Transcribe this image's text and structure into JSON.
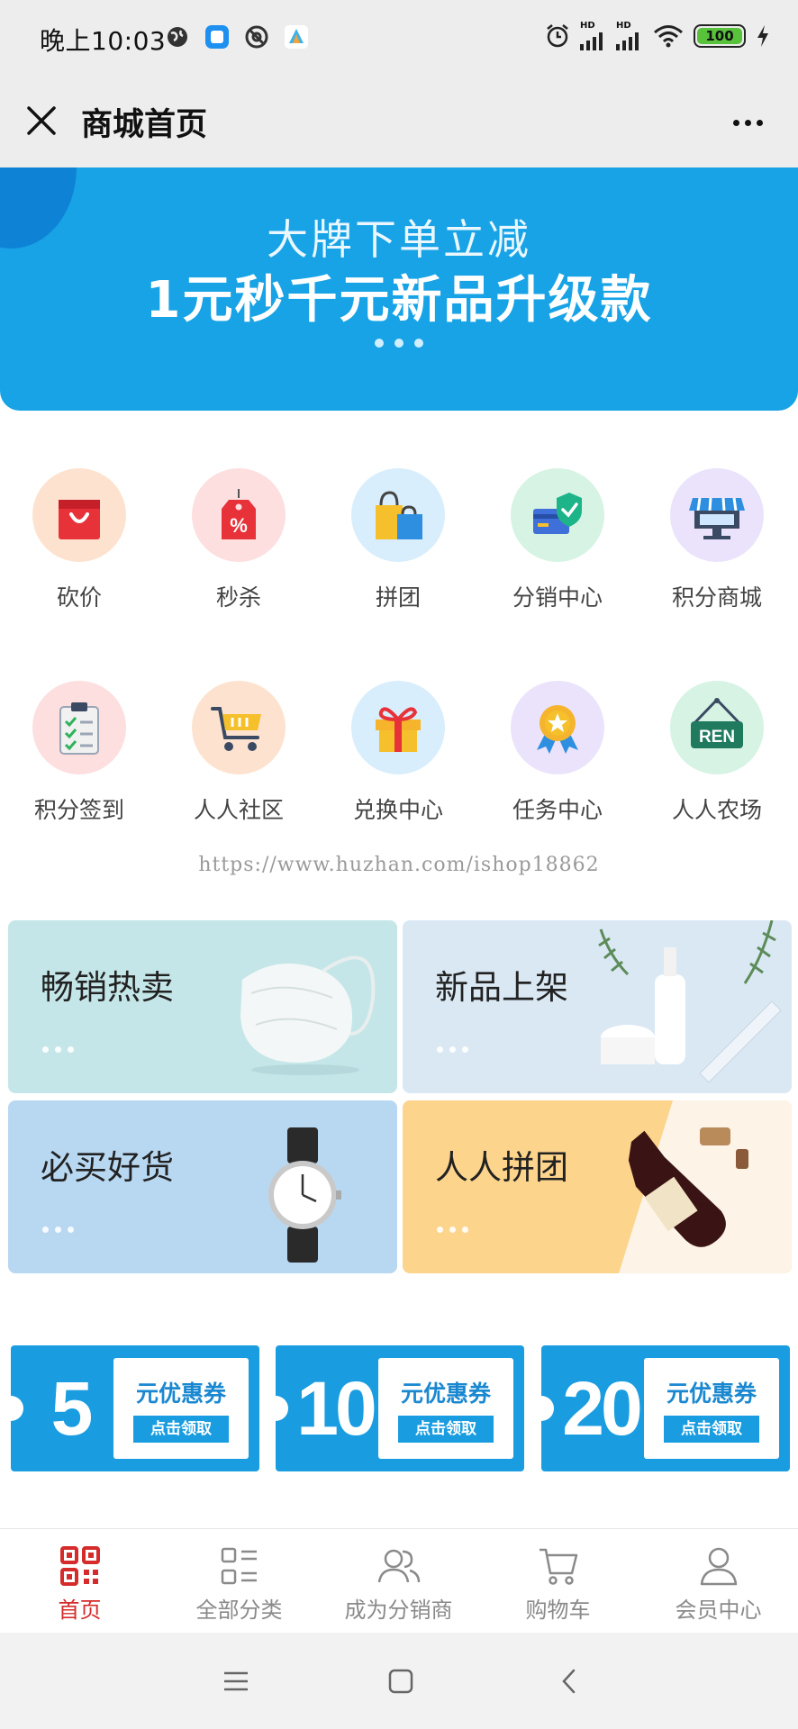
{
  "status_bar": {
    "time": "晚上10:03",
    "battery": "100",
    "hd1": "HD",
    "hd2": "HD"
  },
  "title_bar": {
    "title": "商城首页"
  },
  "banner": {
    "line1": "大牌下单立减",
    "line2": "1元秒千元新品升级款"
  },
  "grid": {
    "row1": [
      {
        "label": "砍价",
        "icon": "shopping-bag-icon",
        "bg": "#fde3cf"
      },
      {
        "label": "秒杀",
        "icon": "price-tag-icon",
        "bg": "#fddfe0"
      },
      {
        "label": "拼团",
        "icon": "shopping-bags-icon",
        "bg": "#d8eefc"
      },
      {
        "label": "分销中心",
        "icon": "shield-card-icon",
        "bg": "#d6f3e4"
      },
      {
        "label": "积分商城",
        "icon": "storefront-icon",
        "bg": "#ebe3fb"
      }
    ],
    "row2": [
      {
        "label": "积分签到",
        "icon": "checklist-icon",
        "bg": "#fddfe0"
      },
      {
        "label": "人人社区",
        "icon": "shopping-cart-icon",
        "bg": "#fde3cf"
      },
      {
        "label": "兑换中心",
        "icon": "gift-icon",
        "bg": "#d8eefc"
      },
      {
        "label": "任务中心",
        "icon": "medal-icon",
        "bg": "#ebe3fb"
      },
      {
        "label": "人人农场",
        "icon": "hanging-sign-icon",
        "bg": "#d6f3e4",
        "sign_text": "REN"
      }
    ]
  },
  "watermark": "https://www.huzhan.com/ishop18862",
  "promos": [
    {
      "title": "畅销热卖",
      "bg": "#c5e6e8"
    },
    {
      "title": "新品上架",
      "bg": "#dae8f3"
    },
    {
      "title": "必买好货",
      "bg": "#b8d8f2"
    },
    {
      "title": "人人拼团",
      "bg": "#fcd48c"
    }
  ],
  "coupons": [
    {
      "amount": "5",
      "text": "元优惠券",
      "button": "点击领取"
    },
    {
      "amount": "10",
      "text": "元优惠券",
      "button": "点击领取"
    },
    {
      "amount": "20",
      "text": "元优惠券",
      "button": "点击领取"
    }
  ],
  "tabs": [
    {
      "label": "首页",
      "icon": "qr-code-icon",
      "active": true
    },
    {
      "label": "全部分类",
      "icon": "category-grid-icon",
      "active": false
    },
    {
      "label": "成为分销商",
      "icon": "users-icon",
      "active": false
    },
    {
      "label": "购物车",
      "icon": "cart-icon",
      "active": false
    },
    {
      "label": "会员中心",
      "icon": "user-icon",
      "active": false
    }
  ],
  "colors": {
    "accent": "#d52b2b",
    "banner": "#18a3e6",
    "coupon": "#1a9de0"
  }
}
